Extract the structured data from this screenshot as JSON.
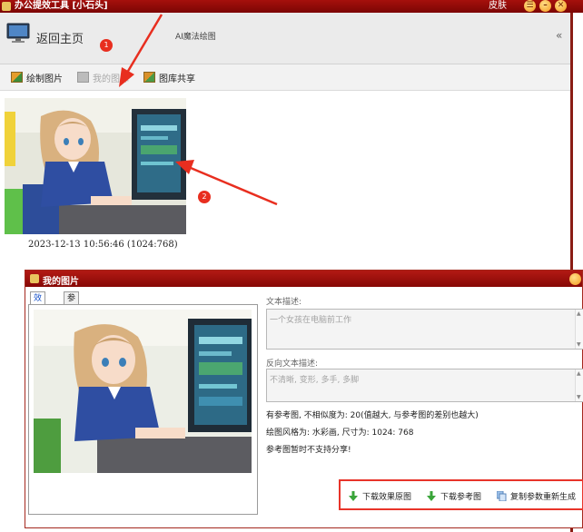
{
  "window": {
    "title": "办公提效工具 [小石头]",
    "skin_label": "皮肤",
    "buttons": {
      "menu": "☰",
      "minimize": "–",
      "close": "✕"
    }
  },
  "nav": {
    "home_label": "返回主页",
    "section_label": "AI魔法绘图",
    "collapse_glyph": "«"
  },
  "toolbar": {
    "draw_label": "绘制图片",
    "gallery_label": "我的图库",
    "share_label": "图库共享"
  },
  "gallery": {
    "items": [
      {
        "caption": "2023-12-13 10:56:46 (1024:768)"
      }
    ]
  },
  "annotations": {
    "badge1": "1",
    "badge2": "2"
  },
  "dialog": {
    "title": "我的图片",
    "tabs": [
      {
        "label": "效果图"
      },
      {
        "label": "参考图"
      }
    ],
    "text_desc_label": "文本描述:",
    "text_desc_value": "一个女孩在电脑前工作",
    "neg_desc_label": "反向文本描述:",
    "neg_desc_value": "不清晰, 变形, 多手, 多脚",
    "info_line1": "有参考图, 不相似度为: 20(值越大, 与参考图的差别也越大)",
    "info_line2": "绘图风格为: 水彩画, 尺寸为: 1024: 768",
    "info_line3": "参考图暂时不支持分享!",
    "actions": {
      "download_result": "下载效果原图",
      "download_reference": "下载参考图",
      "copy_params": "复制参数重新生成"
    }
  },
  "colors": {
    "title_bar": "#8e0a07",
    "accent_red": "#e8342a",
    "active_tab_text": "#1550c8"
  }
}
